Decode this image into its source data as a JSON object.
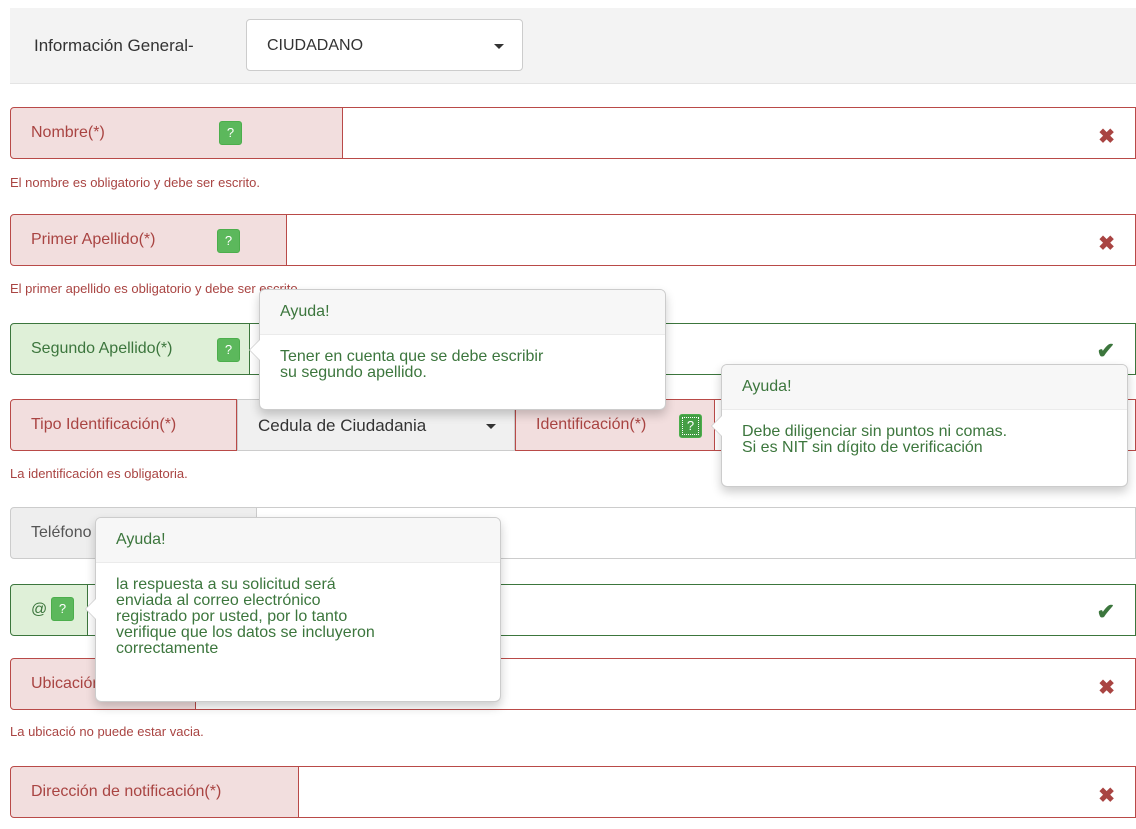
{
  "header": {
    "label": "Información General-",
    "select_value": "CIUDADANO"
  },
  "fields": {
    "nombre": {
      "label": "Nombre(*)",
      "error": "El nombre es obligatorio y debe ser escrito."
    },
    "primer_apellido": {
      "label": "Primer Apellido(*)",
      "error": "El primer apellido es obligatorio y debe ser escrito."
    },
    "segundo_apellido": {
      "label": "Segundo Apellido(*)"
    },
    "tipo_identificacion": {
      "label": "Tipo Identificación(*)",
      "select_value": "Cedula de Ciudadania",
      "error": "La identificación es obligatoria."
    },
    "identificacion": {
      "label": "Identificación(*)"
    },
    "telefono": {
      "label": "Teléfono"
    },
    "email": {
      "label": "@"
    },
    "ubicacion": {
      "label": "Ubicación",
      "error": "La ubicació no puede estar vacia."
    },
    "direccion": {
      "label": "Dirección de notificación(*)"
    }
  },
  "help_glyph": "?",
  "status_icons": {
    "error": "✖",
    "ok": "✔"
  },
  "popovers": {
    "segundo_apellido": {
      "title": "Ayuda!",
      "lines": [
        "Tener en cuenta que se debe escribir",
        "su segundo apellido."
      ]
    },
    "identificacion": {
      "title": "Ayuda!",
      "lines": [
        "Debe diligenciar sin puntos ni comas.",
        "Si es NIT sin dígito de verificación"
      ]
    },
    "email": {
      "title": "Ayuda!",
      "lines": [
        "la respuesta a su solicitud será",
        "enviada al correo electrónico",
        "registrado por usted, por lo tanto",
        "verifique que los datos se incluyeron",
        "correctamente"
      ]
    }
  },
  "colors": {
    "error": "#a94442",
    "success": "#3c763d",
    "help_button": "#5cb85c"
  }
}
